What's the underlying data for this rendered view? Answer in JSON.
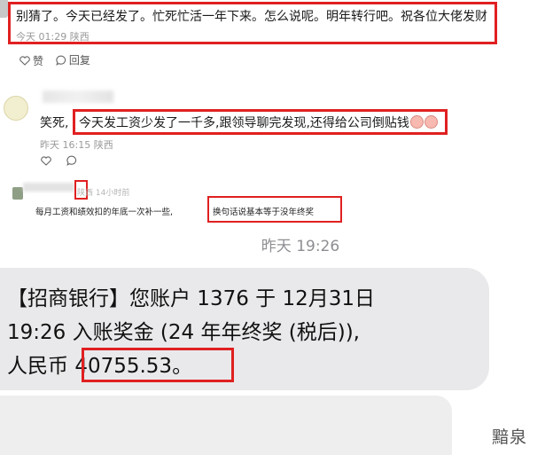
{
  "comment1": {
    "text": "别猜了。今天已经发了。忙死忙活一年下来。怎么说呢。明年转行吧。祝各位大佬发财",
    "meta": "今天 01:29 陕西",
    "like_label": "赞",
    "reply_label": "回复"
  },
  "comment2": {
    "prefix": "笑死,",
    "text": "今天发工资少发了一千多,跟领导聊完发现,还得给公司倒贴钱",
    "meta": "昨天 16:15 陕西"
  },
  "comment3": {
    "meta": "陕西 14小时前",
    "text_part1": "每月工资和绩效扣的年底一次补一些,",
    "text_part2": "换句话说基本等于没年终奖"
  },
  "sms": {
    "time": "昨天 19:26",
    "line1": "【招商银行】您账户 1376 于 12月31日",
    "line2": "19:26 入账奖金 (24 年年终奖 (税后)),",
    "line3_prefix": "人民币",
    "amount": "40755.53",
    "line3_suffix": "。"
  },
  "watermark": "黯泉"
}
